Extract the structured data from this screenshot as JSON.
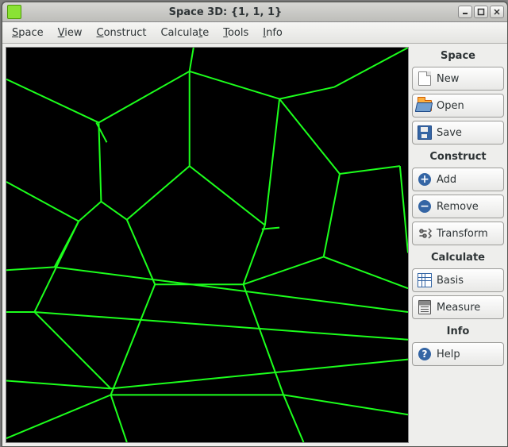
{
  "window": {
    "title": "Space 3D: {1, 1, 1}"
  },
  "menubar": {
    "items": [
      {
        "label": "Space",
        "accel": 0
      },
      {
        "label": "View",
        "accel": 0
      },
      {
        "label": "Construct",
        "accel": 0
      },
      {
        "label": "Calculate",
        "accel": 7
      },
      {
        "label": "Tools",
        "accel": 0
      },
      {
        "label": "Info",
        "accel": 0
      }
    ]
  },
  "side": {
    "groups": [
      {
        "header": "Space",
        "buttons": [
          {
            "label": "New",
            "icon": "new-icon"
          },
          {
            "label": "Open",
            "icon": "open-icon"
          },
          {
            "label": "Save",
            "icon": "save-icon"
          }
        ]
      },
      {
        "header": "Construct",
        "buttons": [
          {
            "label": "Add",
            "icon": "add-icon"
          },
          {
            "label": "Remove",
            "icon": "remove-icon"
          },
          {
            "label": "Transform",
            "icon": "transform-icon"
          }
        ]
      },
      {
        "header": "Calculate",
        "buttons": [
          {
            "label": "Basis",
            "icon": "basis-icon"
          },
          {
            "label": "Measure",
            "icon": "measure-icon"
          }
        ]
      },
      {
        "header": "Info",
        "buttons": [
          {
            "label": "Help",
            "icon": "help-icon"
          }
        ]
      }
    ]
  }
}
